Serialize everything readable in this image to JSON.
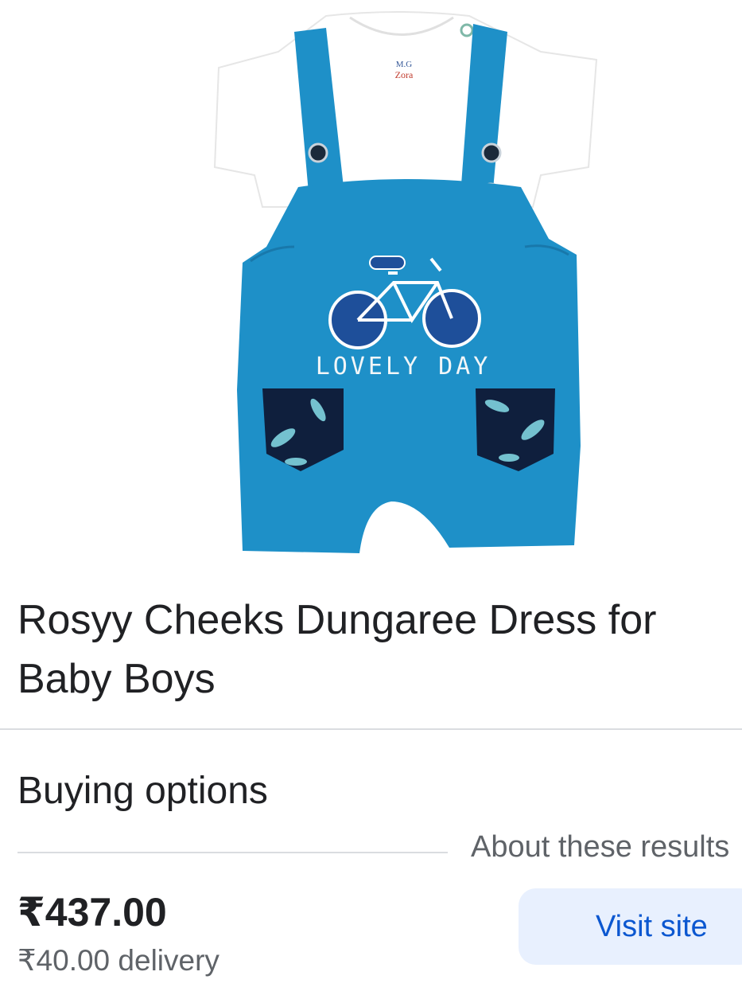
{
  "image": {
    "tag_text_top": "M.G",
    "tag_text_bottom": "Zora",
    "embroidery_text": "LOVELY DAY",
    "colors": {
      "dungaree": "#1e90c8",
      "tshirt": "#ffffff",
      "pocket": "#0f1f3d",
      "accent": "#7fd3df"
    }
  },
  "product": {
    "title": "Rosyy Cheeks Dungaree Dress for Baby Boys"
  },
  "buying_options": {
    "heading": "Buying options",
    "about_link": "About these results",
    "price": "₹437.00",
    "delivery": "₹40.00 delivery",
    "visit_button": "Visit site"
  }
}
